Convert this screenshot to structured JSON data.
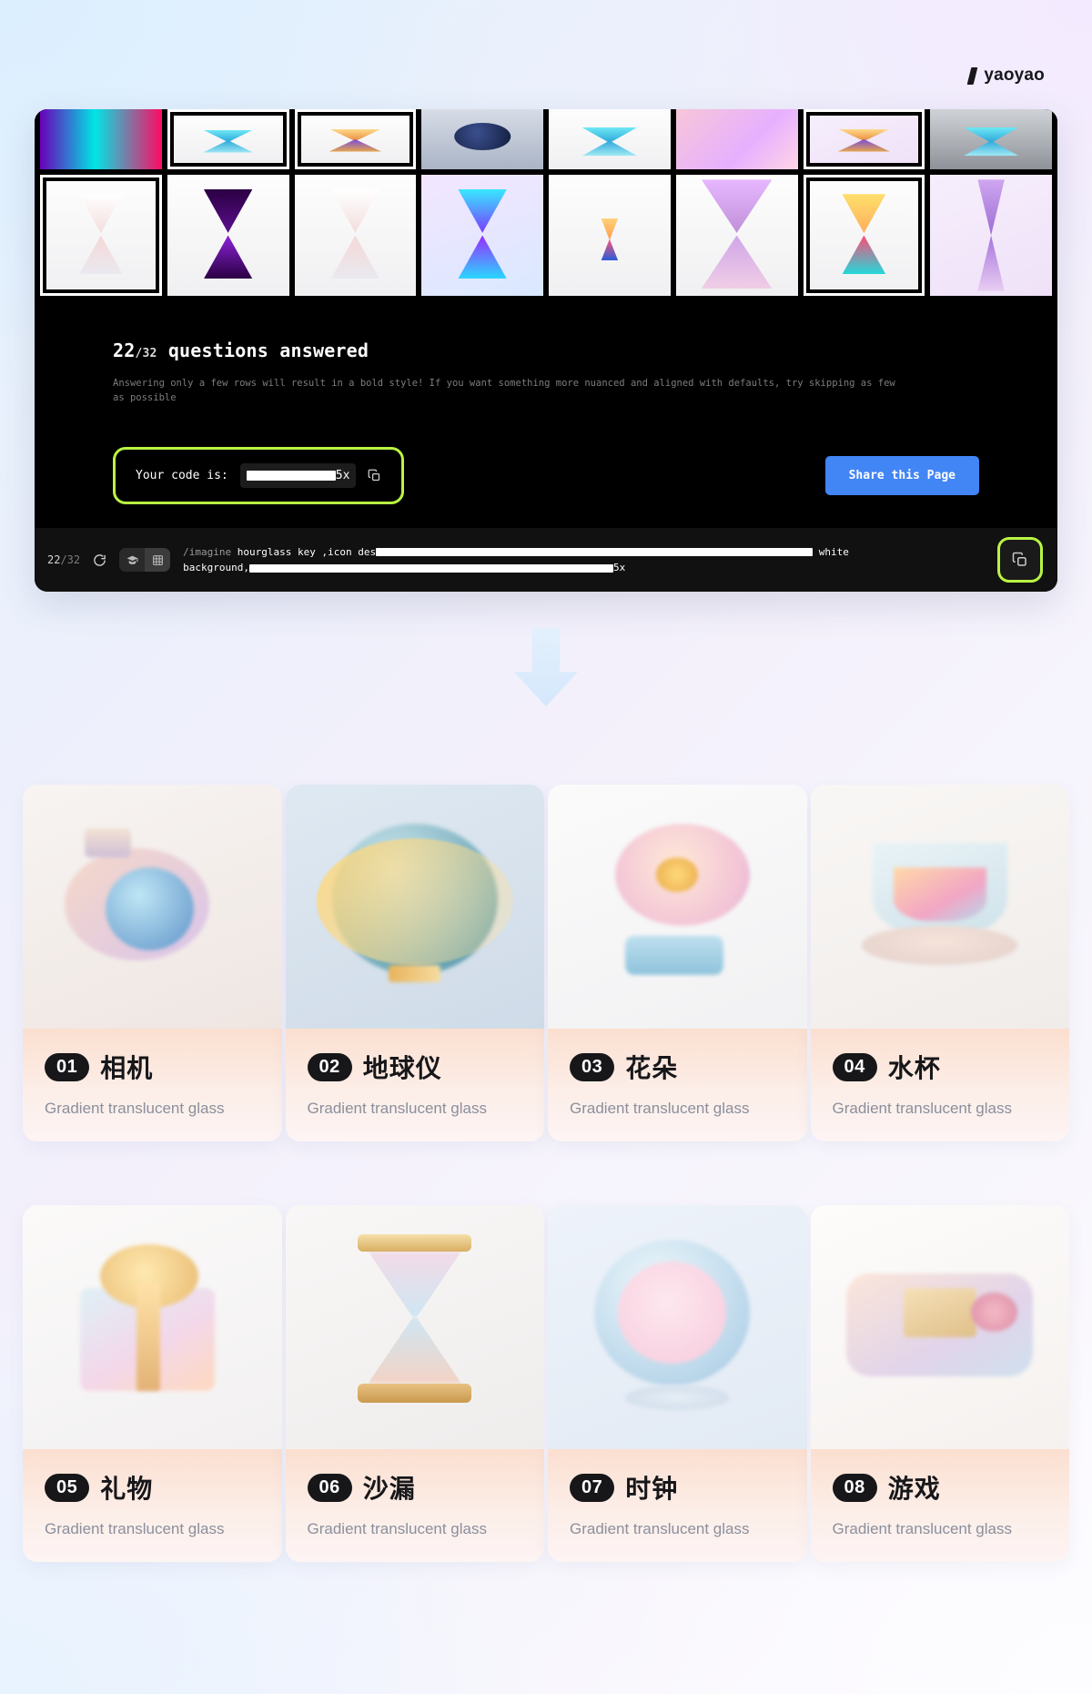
{
  "brand": {
    "name": "yaoyao",
    "mark_icon": "slash-mark-icon"
  },
  "panel": {
    "mosaic": {
      "top_row": [
        {
          "name": "hourglass-blur-pink",
          "selected": false
        },
        {
          "name": "hourglass-pedestal-white",
          "selected": true
        },
        {
          "name": "hourglass-gold-base",
          "selected": true
        },
        {
          "name": "hourglass-navy-ball",
          "selected": false
        },
        {
          "name": "hourglass-cyan-small",
          "selected": false
        },
        {
          "name": "hourglass-pink-gradient",
          "selected": false
        },
        {
          "name": "hourglass-rainbow-base",
          "selected": true
        },
        {
          "name": "hourglass-cyan-cone",
          "selected": false
        }
      ],
      "bottom_row": [
        {
          "name": "hourglass-pastel-swirl",
          "selected": true
        },
        {
          "name": "hourglass-purple-neon",
          "selected": false
        },
        {
          "name": "hourglass-milk-white",
          "selected": false
        },
        {
          "name": "hourglass-cyber-blue",
          "selected": false
        },
        {
          "name": "hourglass-tiny-orange",
          "selected": false
        },
        {
          "name": "hourglass-chrome-twist",
          "selected": false
        },
        {
          "name": "hourglass-rainbow-glass",
          "selected": true
        },
        {
          "name": "hourglass-silk-fabric",
          "selected": false
        }
      ]
    },
    "stats": {
      "answered": "22",
      "denominator": "/32",
      "title_suffix": " questions answered",
      "description": "Answering only a few rows will result in a bold style! If you want something more nuanced and aligned with defaults, try skipping as few as possible"
    },
    "code": {
      "label": "Your code is:",
      "value_redacted": true,
      "value_suffix": "5x",
      "copy_icon": "copy-icon"
    },
    "share_button": {
      "label": "Share this Page",
      "color": "#4285f4"
    },
    "prompt_bar": {
      "count": "22",
      "count_total": "/32",
      "refresh_icon": "refresh-icon",
      "view_toggle": [
        {
          "name": "graduation-cap-icon",
          "active": false
        },
        {
          "name": "grid-view-icon",
          "active": true
        }
      ],
      "prompt_line_1_cmd": "/imagine",
      "prompt_line_1_visible": " hourglass key ,icon des",
      "prompt_line_1_tail": " white",
      "prompt_line_2_visible": "background,",
      "prompt_line_2_tail": "5x",
      "copy_icon": "copy-icon"
    },
    "highlight_color": "#b9f542"
  },
  "arrow": {
    "name": "down-arrow-icon",
    "color": "#d8ebfb"
  },
  "cards": [
    {
      "num": "01",
      "title": "相机",
      "subtitle": "Gradient translucent glass",
      "art": "art-camera"
    },
    {
      "num": "02",
      "title": "地球仪",
      "subtitle": "Gradient translucent glass",
      "art": "art-globe"
    },
    {
      "num": "03",
      "title": "花朵",
      "subtitle": "Gradient translucent glass",
      "art": "art-flower"
    },
    {
      "num": "04",
      "title": "水杯",
      "subtitle": "Gradient translucent glass",
      "art": "art-cup"
    },
    {
      "num": "05",
      "title": "礼物",
      "subtitle": "Gradient translucent glass",
      "art": "art-gift"
    },
    {
      "num": "06",
      "title": "沙漏",
      "subtitle": "Gradient translucent glass",
      "art": "art-hour"
    },
    {
      "num": "07",
      "title": "时钟",
      "subtitle": "Gradient translucent glass",
      "art": "art-clock"
    },
    {
      "num": "08",
      "title": "游戏",
      "subtitle": "Gradient translucent glass",
      "art": "art-game"
    }
  ]
}
